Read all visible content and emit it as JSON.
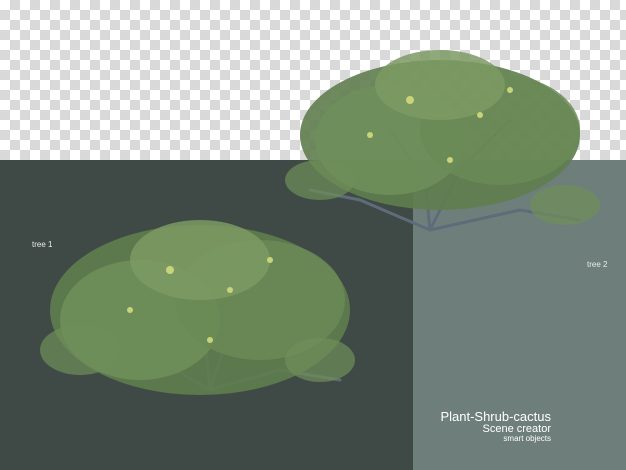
{
  "labels": {
    "tree1": "tree 1",
    "tree2": "tree 2"
  },
  "caption": {
    "line1": "Plant-Shrub-cactus",
    "line2": "Scene creator",
    "line3": "smart objects"
  },
  "colors": {
    "checker_light": "#ffffff",
    "checker_dark": "#d9d9d9",
    "panel_dark": "#3f4a47",
    "panel_light": "#6e7f7b",
    "foliage": "#6f8f5a",
    "foliage_highlight": "#c8d37a",
    "branch": "#5e6c7a"
  }
}
